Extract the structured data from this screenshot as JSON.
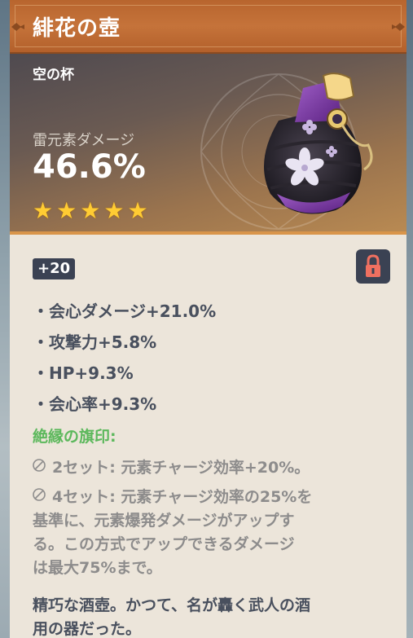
{
  "artifact": {
    "title": "緋花の壺",
    "type": "空の杯",
    "main_stat_label": "雷元素ダメージ",
    "main_stat_value": "46.6%",
    "rarity_stars": 5,
    "level": "+20",
    "locked": true,
    "substats": [
      "・会心ダメージ+21.0%",
      "・攻撃力+5.8%",
      "・HP+9.3%",
      "・会心率+9.3%"
    ],
    "set_name": "絶縁の旗印:",
    "set_bonuses": [
      {
        "lines": [
          "2セット: 元素チャージ効率+20%。"
        ]
      },
      {
        "lines": [
          "4セット: 元素チャージ効率の25%を",
          "基準に、元素爆発ダメージがアップす",
          "る。この方式でアップできるダメージ",
          "は最大75%まで。"
        ]
      }
    ],
    "flavor_lines": [
      "精巧な酒壺。かつて、名が轟く武人の酒",
      "用の器だった。"
    ]
  },
  "icons": {
    "star": "star-icon",
    "lock": "lock-icon",
    "inactive_bonus": "no-entry-icon"
  },
  "colors": {
    "title_bar": "#c5733a",
    "star": "#ffcc33",
    "set_name": "#5cb85c",
    "badge_bg": "#3b4253",
    "lock": "#f07060"
  }
}
